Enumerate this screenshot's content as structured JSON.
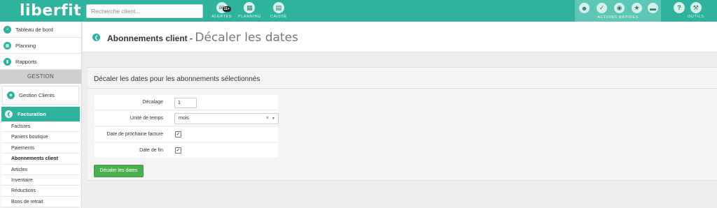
{
  "app": {
    "logo": "liberfit"
  },
  "topbar": {
    "search_placeholder": "Recherche client...",
    "alertes": {
      "label": "ALERTES",
      "badge": "11+"
    },
    "planning": {
      "label": "PLANNING"
    },
    "caisse": {
      "label": "CAISSE"
    },
    "actions_rapides": {
      "label": "ACTIONS RAPIDES"
    },
    "outils": {
      "label": "OUTILS"
    }
  },
  "sidebar": {
    "nav": [
      {
        "label": "Tableau de bord",
        "icon": "home-icon"
      },
      {
        "label": "Planning",
        "icon": "calendar-icon"
      },
      {
        "label": "Rapports",
        "icon": "chart-icon"
      }
    ],
    "section": "GESTION",
    "gestion_clients": "Gestion Clients",
    "facturation": "Facturation",
    "sub_items": [
      {
        "label": "Factures",
        "active": false
      },
      {
        "label": "Paniers boutique",
        "active": false
      },
      {
        "label": "Paiements",
        "active": false
      },
      {
        "label": "Abonnements client",
        "active": true
      },
      {
        "label": "Articles",
        "active": false
      },
      {
        "label": "Inventaire",
        "active": false
      },
      {
        "label": "Réductions",
        "active": false
      },
      {
        "label": "Bons de retrait",
        "active": false
      }
    ]
  },
  "page": {
    "title": "Abonnements client -",
    "subtitle": "Décaler les dates"
  },
  "form": {
    "title": "Décaler les dates pour les abonnements sélectionnés",
    "decalage_label": "Décalage",
    "decalage_value": "1",
    "unite_label": "Unité de temps",
    "unite_value": "mois",
    "prochaine_label": "Date de prochaine facture",
    "prochaine_checked": true,
    "fin_label": "Date de fin",
    "fin_checked": true,
    "submit_label": "Décaler les dates"
  },
  "colors": {
    "brand": "#2db39e",
    "button": "#4caf50"
  }
}
